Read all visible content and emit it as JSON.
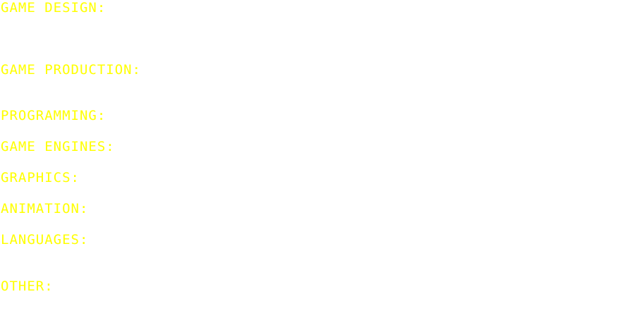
{
  "sections": [
    {
      "label": "GAME DESIGN:"
    },
    {
      "label": "GAME PRODUCTION:"
    },
    {
      "label": "PROGRAMMING:"
    },
    {
      "label": "GAME ENGINES:"
    },
    {
      "label": "GRAPHICS:"
    },
    {
      "label": "ANIMATION:"
    },
    {
      "label": "LANGUAGES:"
    },
    {
      "label": "OTHER:"
    }
  ],
  "colors": {
    "text": "#ffff00",
    "background": "#ffffff"
  }
}
